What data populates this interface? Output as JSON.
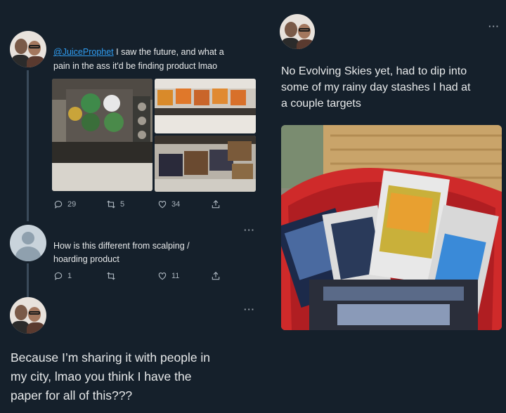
{
  "left_thread": {
    "tweet1": {
      "handle": "@JuiceProphet",
      "text_line1": "I saw the future, and what a",
      "text_line2": "pain in the ass it'd be finding product lmao",
      "actions": {
        "replies": "29",
        "retweets": "5",
        "likes": "34"
      }
    },
    "tweet2": {
      "text_line1": "How is this different from scalping /",
      "text_line2": "hoarding product",
      "actions": {
        "replies": "1",
        "retweets": "",
        "likes": "11"
      }
    },
    "tweet3": {
      "text_line1": "Because I’m sharing it with people in",
      "text_line2": "my city, lmao you think I have the",
      "text_line3": "paper for all of this???"
    }
  },
  "right_tweet": {
    "text_line1": "No Evolving Skies yet, had to dip into",
    "text_line2": "some of my rainy day stashes I had at",
    "text_line3": "a couple targets"
  },
  "icons": {
    "more": "more-options-icon",
    "reply": "reply-icon",
    "retweet": "retweet-icon",
    "like": "like-icon",
    "share": "share-icon"
  },
  "more_glyph": "···"
}
